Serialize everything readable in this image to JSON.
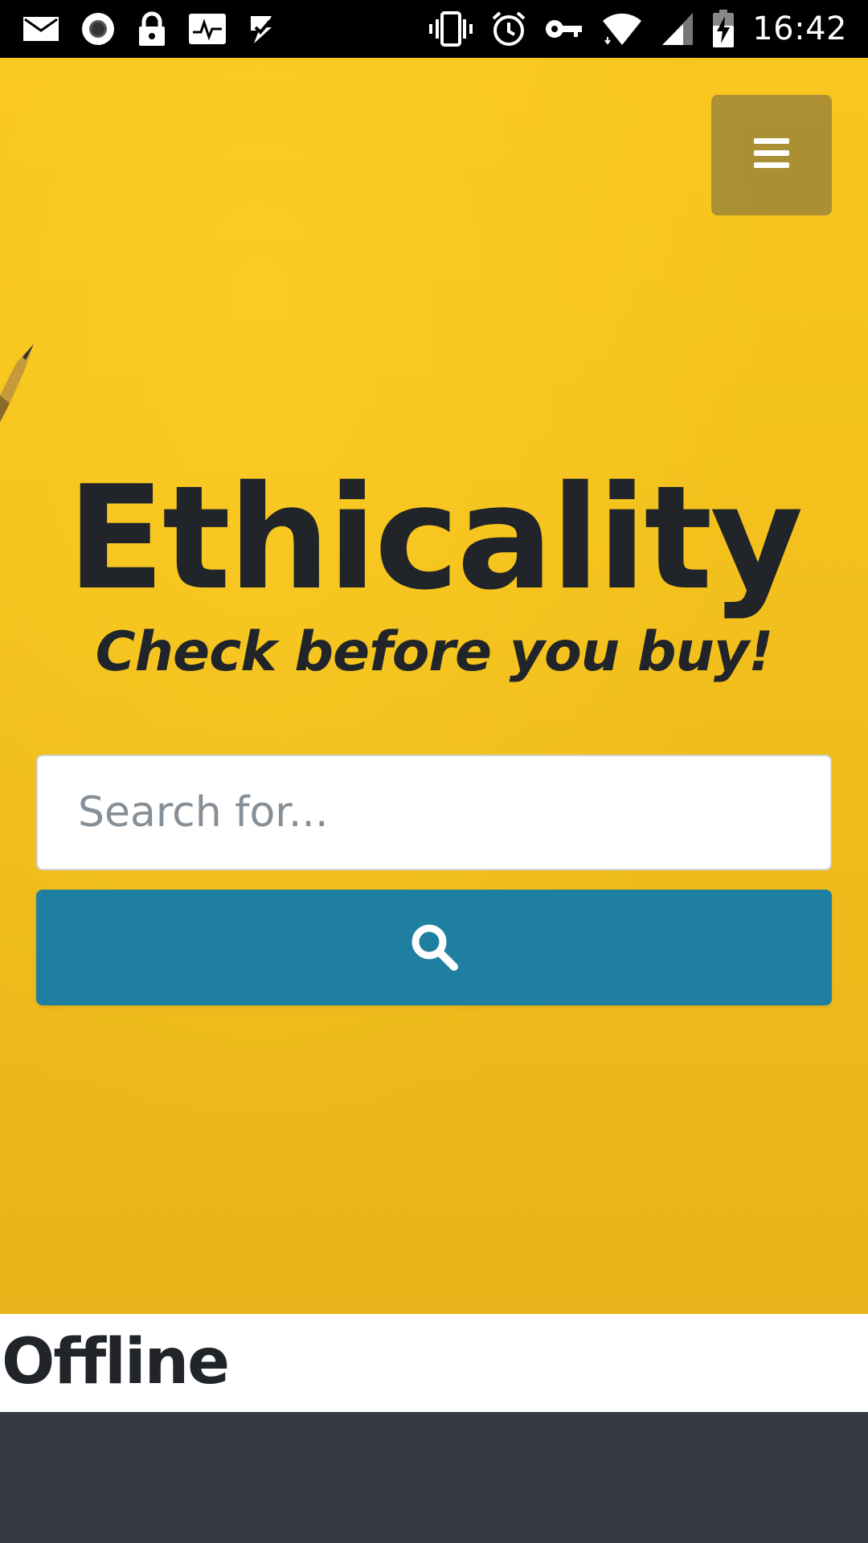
{
  "status_bar": {
    "time": "16:42",
    "left_icons": [
      "mail-icon",
      "record-icon",
      "lock-icon",
      "activity-icon",
      "task-check-icon"
    ],
    "right_icons": [
      "vibrate-icon",
      "alarm-icon",
      "vpn-key-icon",
      "wifi-icon",
      "signal-icon",
      "battery-charging-icon"
    ]
  },
  "hero": {
    "title": "Ethicality",
    "subtitle": "Check before you buy!",
    "menu_icon": "hamburger-menu-icon"
  },
  "search": {
    "placeholder": "Search for...",
    "value": "",
    "button_icon": "search-icon"
  },
  "offline": {
    "heading": "Offline"
  },
  "colors": {
    "hero_background": "#f5c21c",
    "search_button": "#1f7fa0",
    "text_dark": "#212529",
    "footer": "#343a40"
  }
}
